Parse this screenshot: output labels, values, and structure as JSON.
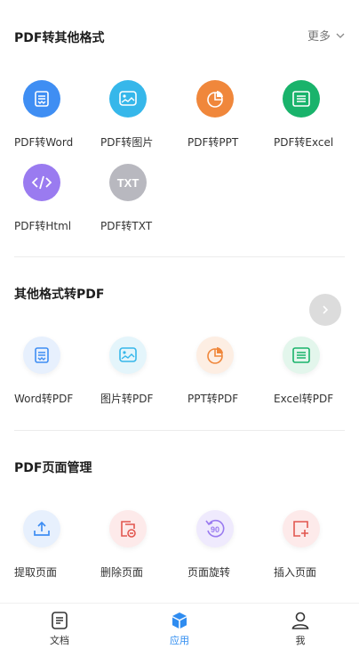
{
  "sections": [
    {
      "title": "PDF转其他格式",
      "more": "更多",
      "tools": [
        {
          "label": "PDF转Word"
        },
        {
          "label": "PDF转图片"
        },
        {
          "label": "PDF转PPT"
        },
        {
          "label": "PDF转Excel"
        },
        {
          "label": "PDF转Html"
        },
        {
          "label": "PDF转TXT"
        }
      ]
    },
    {
      "title": "其他格式转PDF",
      "tools": [
        {
          "label": "Word转PDF"
        },
        {
          "label": "图片转PDF"
        },
        {
          "label": "PPT转PDF"
        },
        {
          "label": "Excel转PDF"
        }
      ]
    },
    {
      "title": "PDF页面管理",
      "tools": [
        {
          "label": "提取页面"
        },
        {
          "label": "删除页面"
        },
        {
          "label": "页面旋转"
        },
        {
          "label": "插入页面"
        }
      ]
    }
  ],
  "icon_text": {
    "txt": "TXT",
    "rotate": "90"
  },
  "bottom_nav": [
    {
      "label": "文档"
    },
    {
      "label": "应用"
    },
    {
      "label": "我"
    }
  ],
  "colors": {
    "word": "#3f8ef3",
    "image": "#36b7ea",
    "ppt": "#f0873b",
    "excel": "#19b36b",
    "html": "#9a7bf0",
    "txt": "#b8b8bf",
    "accent": "#2f8cf0"
  }
}
